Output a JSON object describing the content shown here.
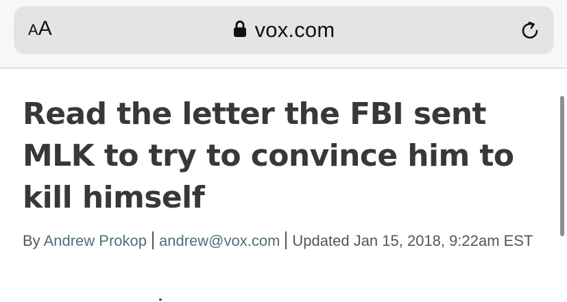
{
  "browser": {
    "text_size_small": "A",
    "text_size_large": "A",
    "domain": "vox.com",
    "icons": [
      "text-size-icon",
      "lock-icon",
      "reload-icon"
    ]
  },
  "article": {
    "headline": "Read the letter the FBI sent MLK to try to convince him to kill himself",
    "byline": {
      "prefix": "By ",
      "author": "Andrew Prokop",
      "email": "andrew@vox.com",
      "updated": "Updated Jan 15, 2018, 9:22am EST"
    }
  },
  "colors": {
    "headline": "#383838",
    "byline_text": "#555555",
    "byline_link": "#4f6f7a",
    "url_bar": "#e4e4e4"
  }
}
